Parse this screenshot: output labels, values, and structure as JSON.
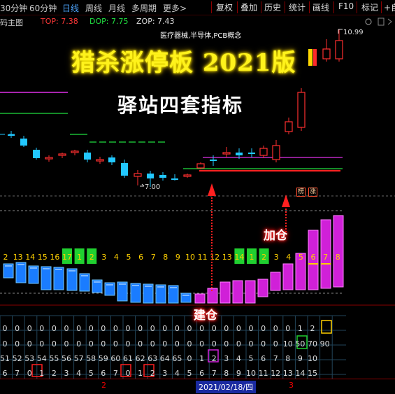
{
  "toolbar": {
    "periods": [
      "30分钟",
      "60分钟",
      "日线",
      "周线",
      "月线",
      "多周期",
      "更多"
    ],
    "active_period": "日线",
    "more_arrow": "更多>",
    "buttons": [
      "复权",
      "叠加",
      "历史",
      "统计",
      "画线",
      "F10",
      "标记",
      "+自"
    ]
  },
  "subheader": {
    "chart_name": "码主图",
    "top": "TOP: 7.38",
    "dop": "DOP: 7.75",
    "zop": "ZOP: 7.43"
  },
  "sector": "医疗器械,半导体,PCB概念",
  "overlay": {
    "title": "猎杀涨停板 2021版",
    "subtitle": "驿站四套指标",
    "build_label": "建仓",
    "add_label": "加仓",
    "badge_left": "榜",
    "badge_right": "涨"
  },
  "price": {
    "high_label": "10.99",
    "low_label": "7.00"
  },
  "counter_row": {
    "labels": [
      "2",
      "13",
      "14",
      "15",
      "16",
      "17",
      "1",
      "2",
      "3",
      "4",
      "5",
      "6",
      "7",
      "8",
      "9",
      "10",
      "11",
      "12",
      "13",
      "14",
      "1",
      "2",
      "3",
      "4",
      "5",
      "6",
      "7",
      "8"
    ]
  },
  "grid": {
    "row1": [
      "0",
      "0",
      "0",
      "0",
      "0",
      "0",
      "0",
      "0",
      "0",
      "0",
      "0",
      "0",
      "0",
      "0",
      "0",
      "0",
      "0",
      "0",
      "0",
      "0",
      "0",
      "0",
      "0",
      "0",
      "1",
      "2"
    ],
    "row2": [
      "0",
      "0",
      "0",
      "0",
      "0",
      "0",
      "0",
      "0",
      "0",
      "0",
      "0",
      "0",
      "0",
      "0",
      "0",
      "0",
      "0",
      "0",
      "0",
      "0",
      "0",
      "0",
      "0",
      "10",
      "50",
      "70",
      "90"
    ],
    "row3": [
      "51",
      "52",
      "53",
      "54",
      "55",
      "56",
      "57",
      "58",
      "59",
      "60",
      "61",
      "62",
      "63",
      "64",
      "65",
      "0",
      "1",
      "2",
      "3",
      "4",
      "5",
      "6",
      "7",
      "8",
      "9",
      "10"
    ],
    "row4": [
      "6",
      "7",
      "0",
      "1",
      "2",
      "3",
      "4",
      "5",
      "6",
      "7",
      "0",
      "1",
      "2",
      "3",
      "4",
      "5",
      "6",
      "7",
      "8",
      "9",
      "10",
      "11",
      "12",
      "13",
      "14",
      "15"
    ]
  },
  "datebar": {
    "left_mark": "2",
    "selected": "2021/02/18/四",
    "right_mark": "3"
  },
  "colors": {
    "up": "#ff3030",
    "down": "#22c8ff",
    "magenta": "#e030e8",
    "green": "#20e040",
    "title_yellow": "#fff21c"
  }
}
